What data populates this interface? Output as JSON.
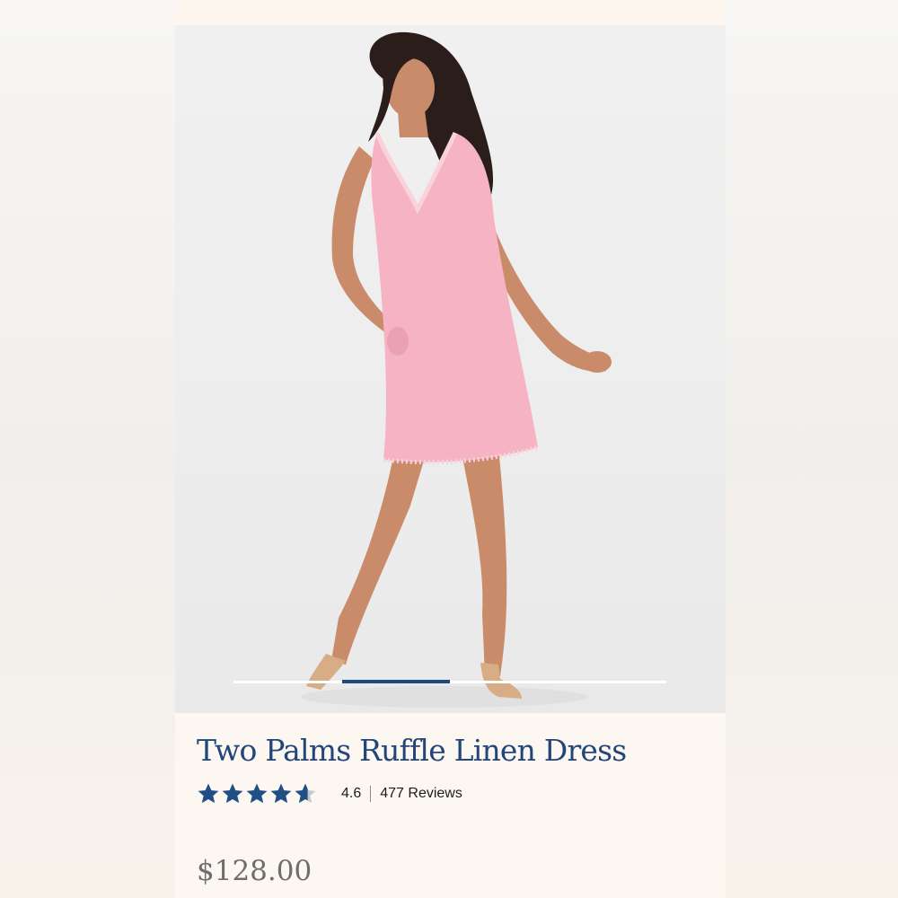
{
  "product": {
    "title": "Two Palms Ruffle Linen Dress",
    "rating_value": "4.6",
    "rating_fraction": 0.92,
    "reviews_label": "477 Reviews",
    "price": "$128.00",
    "image_alt": "Woman wearing pink sleeveless ruffle linen dress"
  },
  "carousel": {
    "slide_count": 4,
    "active_index": 1
  },
  "colors": {
    "brand_navy": "#22467a",
    "star_fill": "#1f4f84",
    "star_empty": "#c8c8c8",
    "dress_pink": "#f5b3c4",
    "page_bg": "#fcf7f1"
  },
  "icons": {
    "rating": "star-icon"
  }
}
